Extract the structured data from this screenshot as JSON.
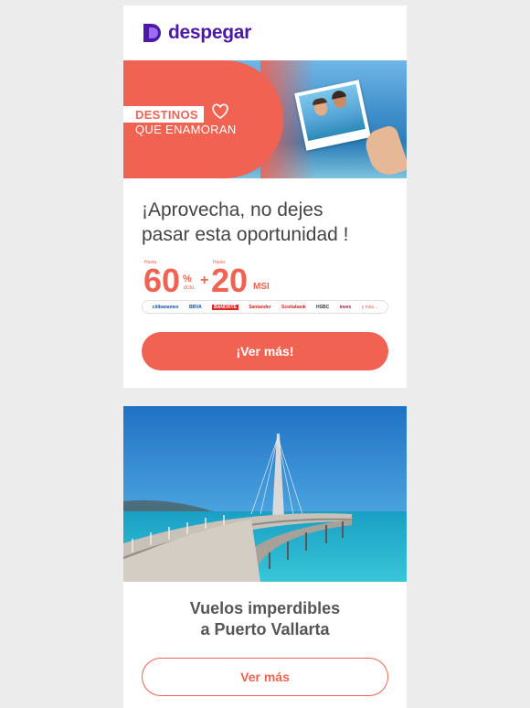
{
  "brand": {
    "name": "despegar",
    "color": "#4b18a8",
    "accent": "#f06251"
  },
  "hero": {
    "line1": "DESTINOS",
    "line2": "QUE ENAMORAN"
  },
  "headline": {
    "line1": "¡Aprovecha, no dejes",
    "line2": "pasar esta oportunidad !"
  },
  "promo": {
    "hasta1": "Hasta",
    "percent_value": "60",
    "percent_sign": "%",
    "dcto": "dcto.",
    "plus": "+",
    "hasta2": "Hasta",
    "msi_value": "20",
    "msi": "MSI"
  },
  "banks": [
    "citibanamex",
    "BBVA",
    "BANORTE",
    "Santander",
    "Scotiabank",
    "HSBC",
    "invex",
    "y más..."
  ],
  "cta_primary": "¡Ver más!",
  "destination": {
    "line1": "Vuelos imperdibles",
    "line2": "a Puerto Vallarta"
  },
  "cta_secondary": "Ver más"
}
